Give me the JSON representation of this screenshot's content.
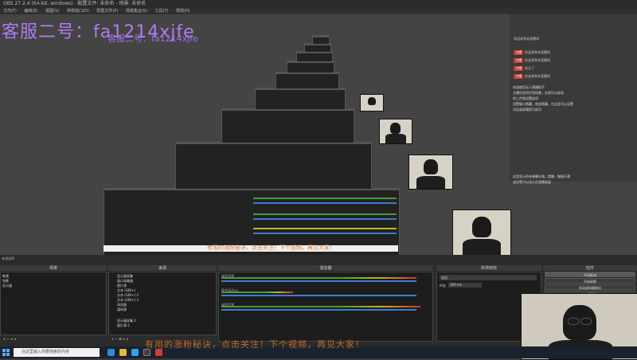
{
  "window": {
    "title": "OBS 27.2.4 (64-bit, windows) - 配置文件: 未命名 - 场景: 未命名"
  },
  "menu": {
    "items": [
      "文件(F)",
      "编辑(E)",
      "视图(V)",
      "停靠窗口(D)",
      "配置文件(P)",
      "场景集合(S)",
      "工具(T)",
      "帮助(H)"
    ]
  },
  "overlay": {
    "watermark": "客服二号：fa1214xjfe",
    "watermark_small": "客服二号：fa1214xjfe"
  },
  "chat": {
    "messages": [
      {
        "tag": "",
        "text": "欢迎来到本直播间"
      },
      {
        "tag": "主播",
        "text": "欢迎来到本直播间"
      },
      {
        "tag": "主播",
        "text": "欢迎来到本直播间"
      },
      {
        "tag": "主播",
        "text": "关注了"
      },
      {
        "tag": "主播",
        "text": "欢迎来到本直播间"
      }
    ],
    "block1": "欢迎使用无人直播助手\n主播信息同步到场景，右侧可以修改\n的上传和设置选项\n设置窗口隐藏，底部隐藏，在这里可以设置\n添加录屏幕即可成功",
    "block2": "这里显示的有弹幕礼物，提醒，聚能开通\n成员等可以显示在直播画面"
  },
  "docks": {
    "scenes": {
      "title": "场景",
      "items": [
        "新建",
        "场景",
        "显示器"
      ]
    },
    "sources": {
      "title": "来源",
      "items": [
        "显示器采集",
        "窗口采集器",
        "图片源",
        "文本 (GDI+)",
        "文本 (GDI+) 2",
        "文本 (GDI+) 3",
        "浏览器",
        "媒体源",
        "显示器采集 2",
        "图片源 2"
      ]
    },
    "mixer": {
      "title": "混音器",
      "channels": [
        {
          "name": "桌面音频",
          "level": 0.85,
          "value": "0.0 dB"
        },
        {
          "name": "麦克风/Aux",
          "level": 0.35,
          "value": "0.0 dB"
        },
        {
          "name": "桌面音频",
          "level": 0.9,
          "value": "0.0 dB"
        }
      ]
    },
    "transitions": {
      "title": "转场特效",
      "type": "淡出",
      "duration_label": "时长",
      "duration": "300 ms"
    },
    "controls": {
      "title": "控件",
      "buttons": [
        "开始推流",
        "开始录制",
        "启动虚拟摄像机",
        "工作室模式",
        "设置",
        "退出"
      ]
    }
  },
  "left_panel": {
    "title": "来源选择"
  },
  "taskbar": {
    "search_placeholder": "在这里输入你要搜索的内容"
  },
  "bottom_banner": "有用的涨粉秘诀，点击关注！下个视频，再见大家！",
  "colors": {
    "accent": "#d4732a",
    "watermark": "#b07af0",
    "meter_blue": "#3b7cd6"
  }
}
